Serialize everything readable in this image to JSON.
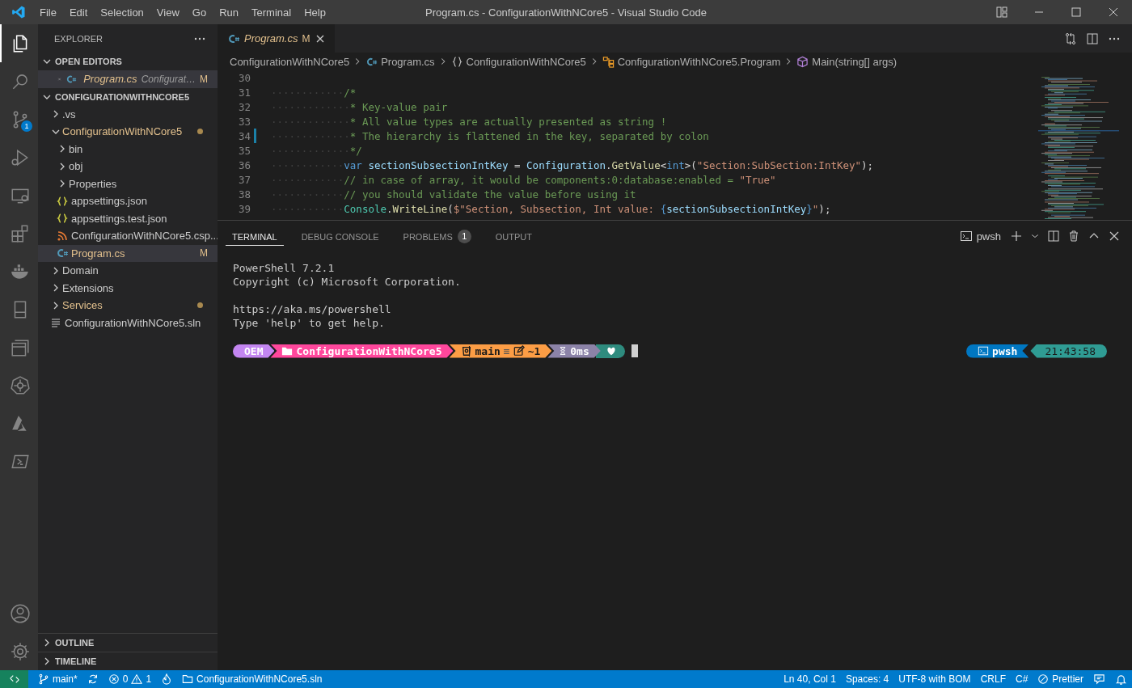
{
  "title_bar": {
    "menu": [
      "File",
      "Edit",
      "Selection",
      "View",
      "Go",
      "Run",
      "Terminal",
      "Help"
    ],
    "title": "Program.cs - ConfigurationWithNCore5 - Visual Studio Code"
  },
  "activity_bar": {
    "items": [
      {
        "selected": true
      },
      {
        "selected": false
      },
      {
        "selected": false,
        "badge": "1"
      },
      {
        "selected": false
      },
      {
        "selected": false
      },
      {
        "selected": false
      },
      {
        "selected": false
      },
      {
        "selected": false
      },
      {
        "selected": false
      },
      {
        "selected": false
      },
      {
        "selected": false
      },
      {
        "selected": false
      }
    ]
  },
  "sidebar": {
    "title": "EXPLORER",
    "open_editors": {
      "title": "OPEN EDITORS",
      "expanded": true,
      "items": [
        {
          "name": "Program.cs",
          "description": "Configurat…",
          "badge": "M",
          "kind": "csharp",
          "selected": true
        }
      ]
    },
    "workspace": {
      "title": "CONFIGURATIONWITHNCORE5",
      "expanded": true,
      "items": [
        {
          "name": ".vs",
          "kind": "folder",
          "expanded": false,
          "modified": false,
          "selected": false
        },
        {
          "name": "ConfigurationWithNCore5",
          "kind": "folder",
          "expanded": true,
          "modified": true,
          "selected": false,
          "children": [
            {
              "name": "bin",
              "kind": "folder",
              "expanded": false,
              "modified": false,
              "selected": false
            },
            {
              "name": "obj",
              "kind": "folder",
              "expanded": false,
              "modified": false,
              "selected": false
            },
            {
              "name": "Properties",
              "kind": "folder",
              "expanded": false,
              "modified": false,
              "selected": false
            },
            {
              "name": "appsettings.json",
              "kind": "json",
              "modified": false,
              "selected": false
            },
            {
              "name": "appsettings.test.json",
              "kind": "json",
              "modified": false,
              "selected": false
            },
            {
              "name": "ConfigurationWithNCore5.csp...",
              "kind": "csproj",
              "modified": false,
              "selected": false
            },
            {
              "name": "Program.cs",
              "kind": "csharp",
              "modified": true,
              "badge": "M",
              "selected": true
            }
          ]
        },
        {
          "name": "Domain",
          "kind": "folder",
          "expanded": false,
          "modified": false,
          "selected": false
        },
        {
          "name": "Extensions",
          "kind": "folder",
          "expanded": false,
          "modified": false,
          "selected": false
        },
        {
          "name": "Services",
          "kind": "folder",
          "expanded": false,
          "modified": true,
          "selected": false
        },
        {
          "name": "ConfigurationWithNCore5.sln",
          "kind": "sln",
          "modified": false,
          "selected": false
        }
      ]
    },
    "sections": [
      {
        "title": "OUTLINE",
        "expanded": false
      },
      {
        "title": "TIMELINE",
        "expanded": false
      }
    ]
  },
  "editor": {
    "tabs": [
      {
        "name": "Program.cs",
        "badge": "M",
        "selected": true,
        "preview": true
      }
    ],
    "breadcrumbs": [
      {
        "text": "ConfigurationWithNCore5",
        "kind": "folder"
      },
      {
        "text": "Program.cs",
        "kind": "csharp"
      },
      {
        "text": "ConfigurationWithNCore5",
        "kind": "namespace"
      },
      {
        "text": "ConfigurationWithNCore5.Program",
        "kind": "class"
      },
      {
        "text": "Main(string[] args)",
        "kind": "method"
      }
    ],
    "lines": [
      {
        "number": "30",
        "changed": false
      },
      {
        "number": "31",
        "indent": "············",
        "changed": false,
        "tokens": [
          {
            "kind": "comment",
            "text": "/*"
          }
        ]
      },
      {
        "number": "32",
        "indent": "·············",
        "changed": false,
        "tokens": [
          {
            "kind": "comment",
            "text": "* Key-value pair"
          }
        ]
      },
      {
        "number": "33",
        "indent": "·············",
        "changed": false,
        "tokens": [
          {
            "kind": "comment",
            "text": "* All value types are actually presented as string !"
          }
        ]
      },
      {
        "number": "34",
        "indent": "·············",
        "changed": true,
        "tokens": [
          {
            "kind": "comment",
            "text": "* The hierarchy is flattened in the key, separated by colon"
          }
        ]
      },
      {
        "number": "35",
        "indent": "·············",
        "changed": false,
        "tokens": [
          {
            "kind": "comment",
            "text": "*/"
          }
        ]
      },
      {
        "number": "36",
        "indent": "············",
        "changed": false,
        "tokens": [
          {
            "kind": "keyword",
            "text": "var"
          },
          {
            "kind": "variable",
            "text": " sectionSubsectionIntKey"
          },
          {
            "kind": "plain",
            "text": " = "
          },
          {
            "kind": "variable",
            "text": "Configuration"
          },
          {
            "kind": "plain",
            "text": "."
          },
          {
            "kind": "method",
            "text": "GetValue"
          },
          {
            "kind": "plain",
            "text": "<"
          },
          {
            "kind": "keyword",
            "text": "int"
          },
          {
            "kind": "plain",
            "text": ">("
          },
          {
            "kind": "string",
            "text": "\"Section:SubSection:IntKey\""
          },
          {
            "kind": "plain",
            "text": ");"
          }
        ]
      },
      {
        "number": "37",
        "indent": "············",
        "changed": false,
        "tokens": [
          {
            "kind": "comment",
            "text": "// in case of array, it would be components:0:database:enabled = "
          },
          {
            "kind": "string",
            "text": "\"True\""
          }
        ]
      },
      {
        "number": "38",
        "indent": "············",
        "changed": false,
        "tokens": [
          {
            "kind": "comment",
            "text": "// you should validate the value before using it"
          }
        ]
      },
      {
        "number": "39",
        "indent": "············",
        "changed": false,
        "tokens": [
          {
            "kind": "class",
            "text": "Console"
          },
          {
            "kind": "plain",
            "text": "."
          },
          {
            "kind": "method",
            "text": "WriteLine"
          },
          {
            "kind": "plain",
            "text": "("
          },
          {
            "kind": "string",
            "text": "$\"Section, Subsection, Int value: "
          },
          {
            "kind": "keyword",
            "text": "{"
          },
          {
            "kind": "variable",
            "text": "sectionSubsectionIntKey"
          },
          {
            "kind": "keyword",
            "text": "}"
          },
          {
            "kind": "string",
            "text": "\""
          },
          {
            "kind": "plain",
            "text": ");"
          }
        ]
      }
    ]
  },
  "panel": {
    "tabs": [
      {
        "label": "TERMINAL",
        "selected": true
      },
      {
        "label": "DEBUG CONSOLE",
        "selected": false
      },
      {
        "label": "PROBLEMS",
        "selected": false,
        "badge": "1"
      },
      {
        "label": "OUTPUT",
        "selected": false
      }
    ],
    "profile": "pwsh",
    "terminal": {
      "blocks": [
        [
          "PowerShell 7.2.1",
          "Copyright (c) Microsoft Corporation."
        ],
        [
          "https://aka.ms/powershell",
          "Type 'help' to get help."
        ]
      ],
      "prompt_left": [
        {
          "kind": "session",
          "text": "OEM",
          "color": "#c386f1"
        },
        {
          "kind": "path",
          "text": "ConfigurationWithNCore5",
          "color": "#ff479c"
        },
        {
          "kind": "git",
          "branch": "main",
          "status": "≡",
          "changes": "~1",
          "color": "#fc9d45"
        },
        {
          "kind": "duration",
          "text": "0ms",
          "color": "#8c83a8"
        },
        {
          "kind": "exit",
          "color": "#2e8b7e"
        }
      ],
      "prompt_right": [
        {
          "kind": "shell",
          "text": "pwsh",
          "color": "#0077c2"
        },
        {
          "kind": "time",
          "text": "21:43:58",
          "color": "#2f9c94"
        }
      ]
    }
  },
  "status_bar": {
    "branch": "main*",
    "errors": "0",
    "warnings": "1",
    "solution": "ConfigurationWithNCore5.sln",
    "right": [
      "Ln 40, Col 1",
      "Spaces: 4",
      "UTF-8 with BOM",
      "CRLF",
      "C#"
    ],
    "formatter": "Prettier"
  }
}
